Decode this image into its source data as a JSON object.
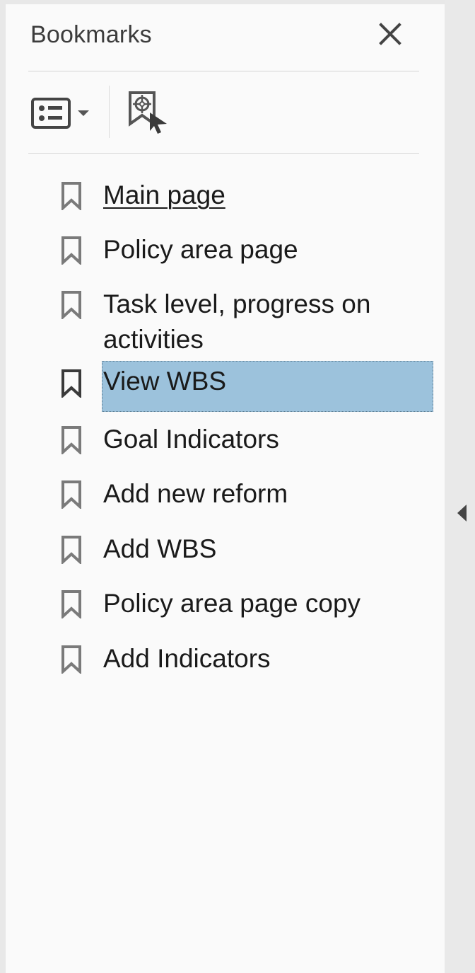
{
  "panel": {
    "title": "Bookmarks",
    "close_icon": "close-icon"
  },
  "toolbar": {
    "options_icon": "list-options-icon",
    "options_dropdown_icon": "dropdown-caret-icon",
    "new_bookmark_icon": "new-bookmark-from-structure-icon"
  },
  "bookmarks": [
    {
      "label": "Main page",
      "underlined": true
    },
    {
      "label": "Policy area page"
    },
    {
      "label": "Task level, progress on activities"
    },
    {
      "label": "View WBS",
      "selected": true
    },
    {
      "label": "Goal Indicators"
    },
    {
      "label": "Add new reform"
    },
    {
      "label": "Add WBS"
    },
    {
      "label": "Policy area page copy"
    },
    {
      "label": "Add Indicators"
    }
  ],
  "colors": {
    "panel_bg": "#fafafa",
    "selection_bg": "#9cc2dc",
    "icon_gray": "#7a7a7a",
    "icon_dark": "#3a3a3a"
  },
  "collapse_icon": "collapse-left-arrow-icon"
}
